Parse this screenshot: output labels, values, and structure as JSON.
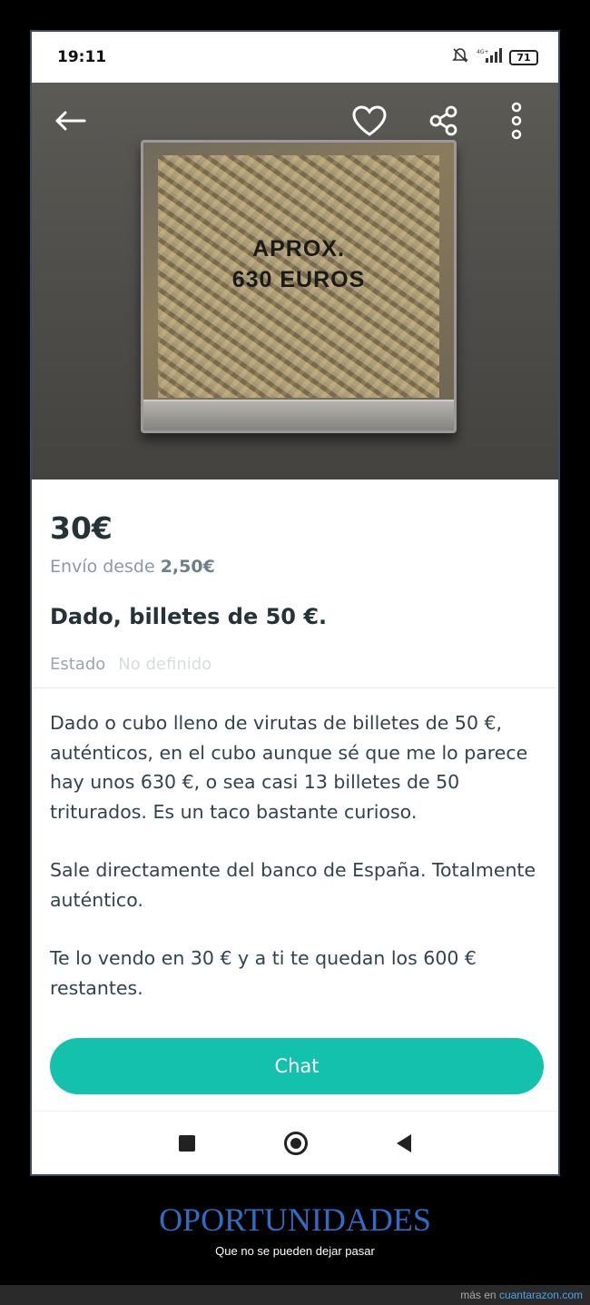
{
  "status": {
    "time": "19:11",
    "battery": "71",
    "network": "4G+"
  },
  "photo": {
    "cube_text_line1": "APROX.",
    "cube_text_line2": "630 EUROS"
  },
  "listing": {
    "price": "30€",
    "shipping_prefix": "Envío desde",
    "shipping_price": "2,50€",
    "title": "Dado, billetes de 50 €.",
    "state_label": "Estado",
    "state_value": "No definido",
    "description": [
      "Dado o cubo lleno de virutas de billetes de 50 €, auténticos, en el cubo aunque sé que me lo parece hay unos 630 €, o sea casi 13 billetes de 50 triturados. Es un taco bastante curioso.",
      "Sale directamente del banco de España. Totalmente auténtico.",
      "Te lo vendo en 30 € y a ti te quedan los 600 € restantes."
    ],
    "chat_label": "Chat"
  },
  "caption": {
    "title": "OPORTUNIDADES",
    "subtitle": "Que no se pueden dejar pasar"
  },
  "footer": {
    "prefix": "más en",
    "link": "cuantarazon.com"
  },
  "colors": {
    "accent": "#13c1ac",
    "caption": "#2f6cc4"
  }
}
